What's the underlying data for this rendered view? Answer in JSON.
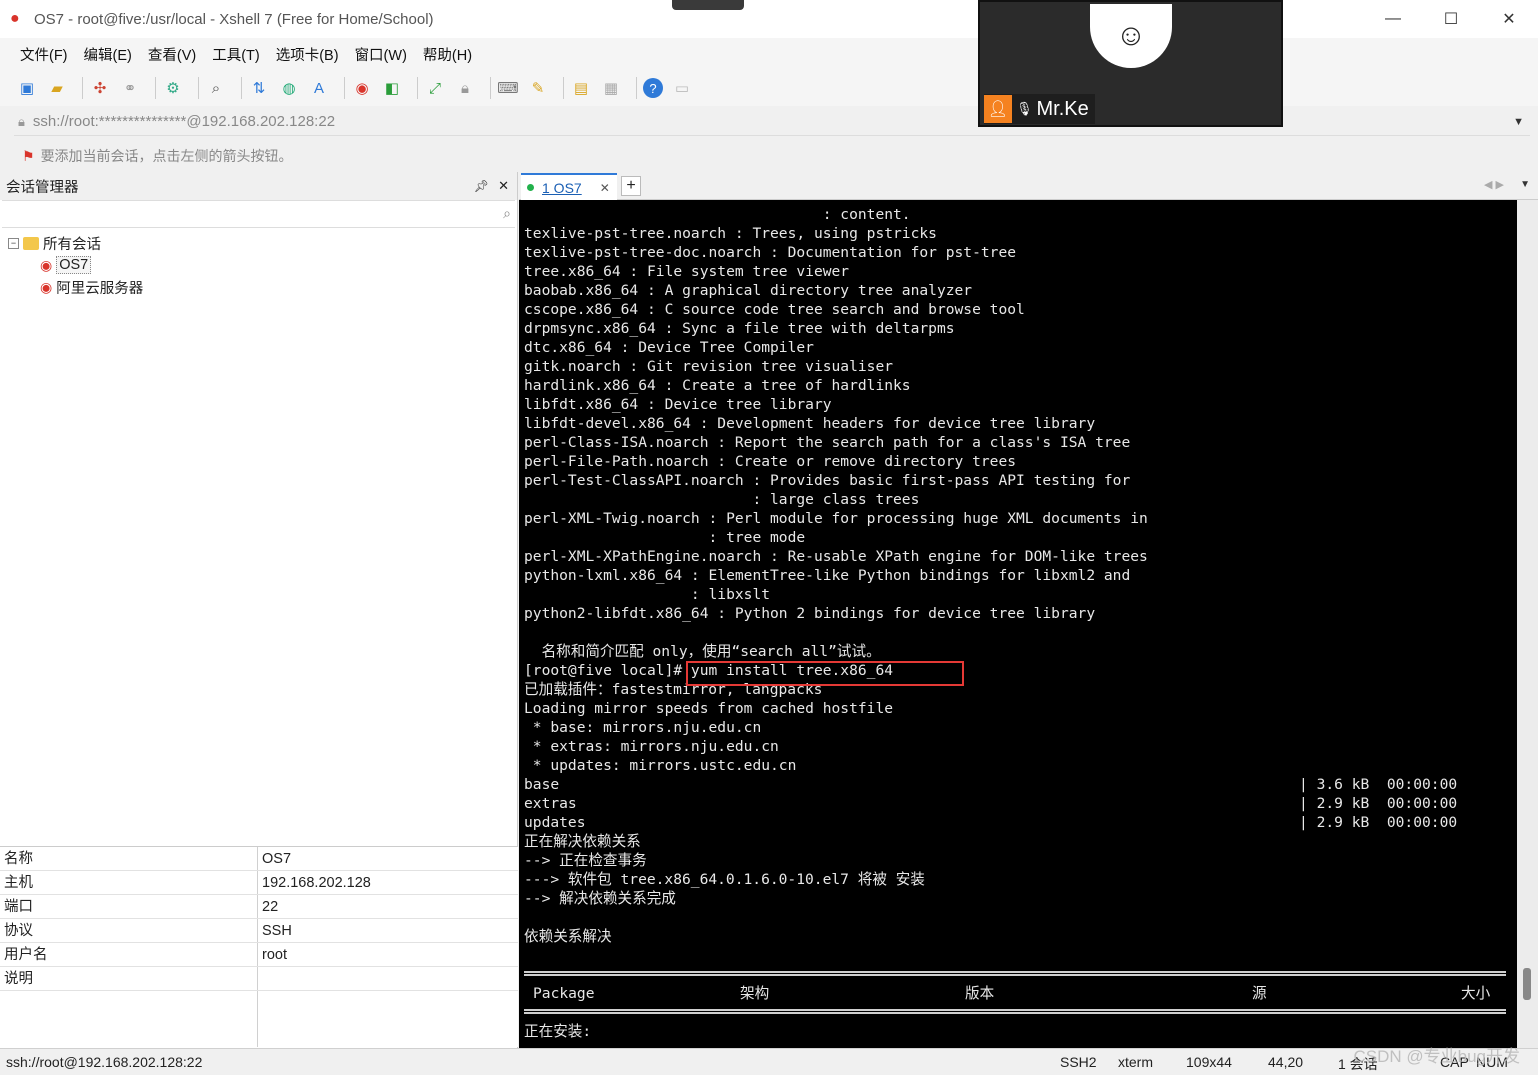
{
  "window": {
    "title": "OS7 - root@five:/usr/local - Xshell 7 (Free for Home/School)",
    "minimize": "—",
    "maximize": "☐",
    "close": "✕"
  },
  "menu": [
    "文件(F)",
    "编辑(E)",
    "查看(V)",
    "工具(T)",
    "选项卡(B)",
    "窗口(W)",
    "帮助(H)"
  ],
  "toolbar_icons": [
    "new-session-icon",
    "open-folder-icon",
    "reconnect-icon",
    "disconnect-icon",
    "properties-icon",
    "find-icon",
    "transfer-icon",
    "globe-icon",
    "font-icon",
    "xshell-icon",
    "xftp-icon",
    "fullscreen-icon",
    "lock-icon",
    "keyboard-icon",
    "highlight-icon",
    "new-folder-icon",
    "layout-icon",
    "help-icon",
    "chat-icon"
  ],
  "address": {
    "value": "ssh://root:***************@192.168.202.128:22"
  },
  "infobar": {
    "message": "要添加当前会话，点击左侧的箭头按钮。"
  },
  "session_manager": {
    "title": "会话管理器",
    "root": "所有会话",
    "items": [
      "OS7",
      "阿里云服务器"
    ],
    "properties": [
      {
        "key": "名称",
        "value": "OS7"
      },
      {
        "key": "主机",
        "value": "192.168.202.128"
      },
      {
        "key": "端口",
        "value": "22"
      },
      {
        "key": "协议",
        "value": "SSH"
      },
      {
        "key": "用户名",
        "value": "root"
      },
      {
        "key": "说明",
        "value": ""
      }
    ]
  },
  "tab": {
    "label": "1 OS7",
    "add": "+"
  },
  "terminal": {
    "lines": [
      "                                  : content.",
      "texlive-pst-tree.noarch : Trees, using pstricks",
      "texlive-pst-tree-doc.noarch : Documentation for pst-tree",
      "tree.x86_64 : File system tree viewer",
      "baobab.x86_64 : A graphical directory tree analyzer",
      "cscope.x86_64 : C source code tree search and browse tool",
      "drpmsync.x86_64 : Sync a file tree with deltarpms",
      "dtc.x86_64 : Device Tree Compiler",
      "gitk.noarch : Git revision tree visualiser",
      "hardlink.x86_64 : Create a tree of hardlinks",
      "libfdt.x86_64 : Device tree library",
      "libfdt-devel.x86_64 : Development headers for device tree library",
      "perl-Class-ISA.noarch : Report the search path for a class's ISA tree",
      "perl-File-Path.noarch : Create or remove directory trees",
      "perl-Test-ClassAPI.noarch : Provides basic first-pass API testing for",
      "                          : large class trees",
      "perl-XML-Twig.noarch : Perl module for processing huge XML documents in",
      "                     : tree mode",
      "perl-XML-XPathEngine.noarch : Re-usable XPath engine for DOM-like trees",
      "python-lxml.x86_64 : ElementTree-like Python bindings for libxml2 and",
      "                   : libxslt",
      "python2-libfdt.x86_64 : Python 2 bindings for device tree library",
      "",
      "  名称和简介匹配 only，使用“search all”试试。",
      "[root@five local]# yum install tree.x86_64",
      "已加载插件：fastestmirror, langpacks",
      "Loading mirror speeds from cached hostfile",
      " * base: mirrors.nju.edu.cn",
      " * extras: mirrors.nju.edu.cn",
      " * updates: mirrors.ustc.edu.cn",
      "base",
      "extras",
      "updates",
      "正在解决依赖关系",
      "--> 正在检查事务",
      "---> 软件包 tree.x86_64.0.1.6.0-10.el7 将被 安装",
      "--> 解决依赖关系完成",
      "",
      "依赖关系解决",
      "",
      "",
      "",
      "",
      "正在安装:"
    ],
    "repo_stats": [
      "| 3.6 kB  00:00:00",
      "| 2.9 kB  00:00:00",
      "| 2.9 kB  00:00:00"
    ],
    "table_headers": [
      "Package",
      "架构",
      "版本",
      "源",
      "大小"
    ]
  },
  "statusbar": {
    "left": "ssh://root@192.168.202.128:22",
    "protocol": "SSH2",
    "term": "xterm",
    "size": "109x44",
    "cursor": "44,20",
    "sessions": "1 会话",
    "caps": "CAP",
    "num": "NUM"
  },
  "watermark": "CSDN @专业bug开发",
  "video": {
    "name": "Mr.Ke"
  },
  "colors": {
    "terminal_bg": "#000000",
    "highlight": "#e53935",
    "tab_accent": "#2f7ad8"
  }
}
